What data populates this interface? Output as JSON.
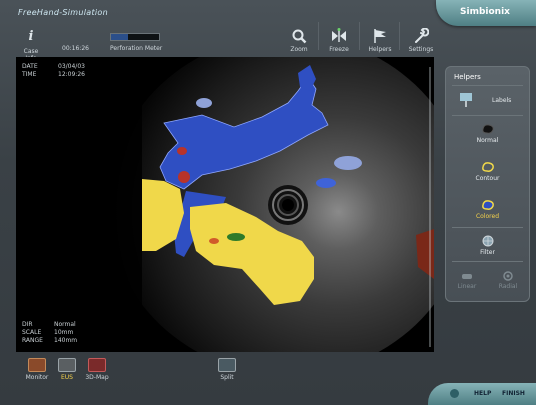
{
  "app": {
    "title": "FreeHand-Simulation",
    "brand": "Simbionix"
  },
  "toolbar": {
    "case_info_label": "Case Info",
    "timer": "00:16:26",
    "perforation_label": "Perforation Meter",
    "perforation_level": 0.35,
    "zoom_label": "Zoom",
    "freeze_label": "Freeze",
    "helpers_label": "Helpers",
    "settings_label": "Settings"
  },
  "viewer": {
    "date_label": "DATE",
    "date_value": "03/04/03",
    "time_label": "TIME",
    "time_value": "12:09:26",
    "dir_label": "DIR",
    "dir_value": "Normal",
    "scale_label": "SCALE",
    "scale_value": "10mm",
    "range_label": "RANGE",
    "range_value": "140mm"
  },
  "helpers_panel": {
    "header": "Helpers",
    "labels_label": "Labels",
    "normal_label": "Normal",
    "contour_label": "Contour",
    "colored_label": "Colored",
    "filter_label": "Filter",
    "linear_label": "Linear",
    "radial_label": "Radial"
  },
  "bottom": {
    "monitor_label": "Monitor",
    "eus_label": "EUS",
    "map3d_label": "3D-Map",
    "split_label": "Split"
  },
  "footer": {
    "help_label": "HELP",
    "finish_label": "FINISH"
  },
  "colors": {
    "accent_teal": "#6f9ea3",
    "selected_yellow": "#f6d34b",
    "vessel_blue": "#2f4fc2",
    "organ_yellow": "#f0d84a"
  }
}
